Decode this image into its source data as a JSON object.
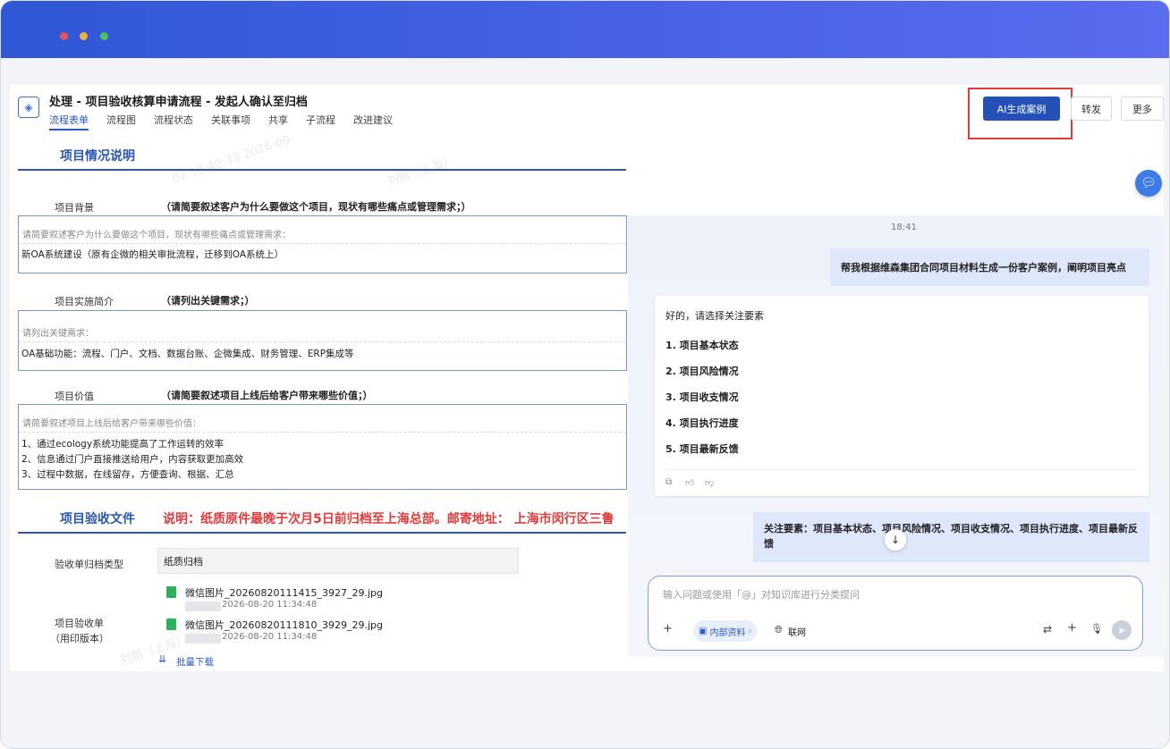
{
  "header": {
    "title": "处理 - 项目验收核算申请流程 - 发起人确认至归档",
    "tabs": [
      "流程表单",
      "流程图",
      "流程状态",
      "关联事项",
      "共享",
      "子流程",
      "改进建议"
    ],
    "buttons": {
      "ai": "AI生成案例",
      "forward": "转发",
      "more": "更多"
    }
  },
  "form": {
    "section1_title": "项目情况说明",
    "background": {
      "label": "项目背景",
      "hint": "（请简要叙述客户为什么要做这个项目，现状有哪些痛点或管理需求；）",
      "placeholder": "请简要叙述客户为什么要做这个项目，现状有哪些痛点或管理需求：",
      "value": "新OA系统建设（原有企微的相关审批流程，迁移到OA系统上）"
    },
    "implementation": {
      "label": "项目实施简介",
      "hint": "（请列出关键需求；）",
      "placeholder": "请列出关键需求：",
      "value": "OA基础功能：流程、门户、文档、数据台账、企微集成、财务管理、ERP集成等"
    },
    "value_sec": {
      "label": "项目价值",
      "hint": "（请简要叙述项目上线后给客户带来哪些价值；）",
      "placeholder": "请简要叙述项目上线后给客户带来哪些价值：",
      "lines": [
        "1、通过ecology系统功能提高了工作运转的效率",
        "2、信息通过门户直接推送给用户，内容获取更加高效",
        "3、过程中数据，在线留存，方便查询、根据、汇总"
      ]
    },
    "section2_title": "项目验收文件",
    "notice": "说明：纸质原件最晚于次月5日前归档至上海总部。邮寄地址： 上海市闵行区三鲁",
    "archive_type": {
      "label": "验收单归档类型",
      "value": "纸质归档"
    },
    "acceptance": {
      "label": "项目验收单",
      "label2": "（用印版本）",
      "files": [
        {
          "name": "微信图片_20260820111415_3927_29.jpg",
          "meta": "2026-08-20 11:34:48"
        },
        {
          "name": "微信图片_20260820111810_3929_29.jpg",
          "meta": "2026-08-20 11:34:48"
        }
      ],
      "batch_download": "批量下载"
    },
    "watermark": [
      "2026-09-",
      "02 18:40:33",
      "刘鹏（上海）",
      "刘鹏（上海） 18:40:33"
    ]
  },
  "chat": {
    "time": "18:41",
    "user_msg1": "帮我根据维森集团合同项目材料生成一份客户案例，阐明项目亮点",
    "bot_intro": "好的，请选择关注要素",
    "bot_items": [
      "1. 项目基本状态",
      "2. 项目风险情况",
      "3. 项目收支情况",
      "4. 项目执行进度",
      "5. 项目最新反馈"
    ],
    "user_msg2": "关注要素：项目基本状态、项目风险情况、项目收支情况、项目执行进度、项目最新反馈",
    "input_placeholder": "输入问题或使用「@」对知识库进行分类提问",
    "chip_label": "内部资料",
    "web_label": "联网"
  },
  "colors": {
    "accent": "#2450b8",
    "section": "#2b56b7",
    "notice": "#e23a3a",
    "highlight_box": "#e33a3a"
  }
}
